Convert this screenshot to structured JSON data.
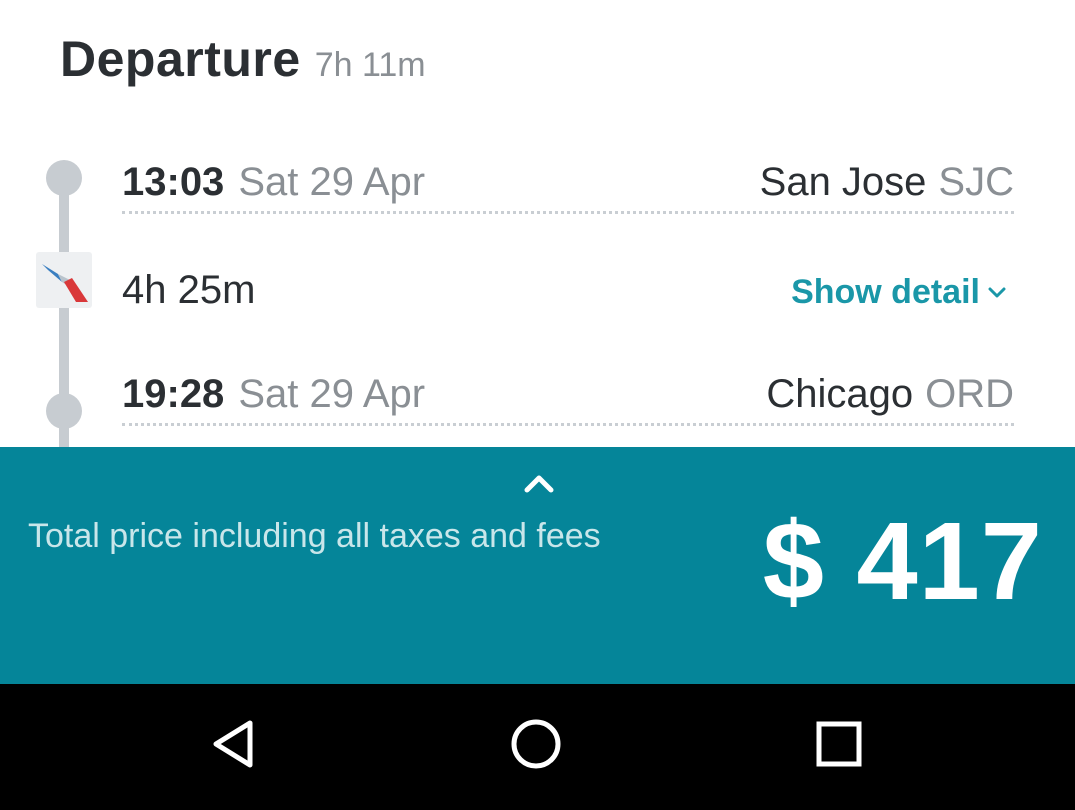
{
  "header": {
    "title": "Departure",
    "total_duration": "7h 11m"
  },
  "segment": {
    "departure": {
      "time": "13:03",
      "date": "Sat 29 Apr",
      "city": "San Jose",
      "code": "SJC"
    },
    "flight_duration": "4h 25m",
    "airline_logo_icon": "american-airlines-logo-icon",
    "show_detail_label": "Show detail",
    "arrival": {
      "time": "19:28",
      "date": "Sat 29 Apr",
      "city": "Chicago",
      "code": "ORD"
    }
  },
  "price_bar": {
    "label": "Total price including all taxes and fees",
    "price": "$ 417",
    "expand_icon": "chevron-up-icon"
  },
  "nav_bar": {
    "back_icon": "back-triangle-icon",
    "home_icon": "home-circle-icon",
    "recents_icon": "recents-square-icon"
  },
  "colors": {
    "accent": "#1a97a8",
    "price_bar_bg": "#058599",
    "text_primary": "#2b2f33",
    "text_secondary": "#8a8f94",
    "timeline": "#c7ccd1"
  }
}
